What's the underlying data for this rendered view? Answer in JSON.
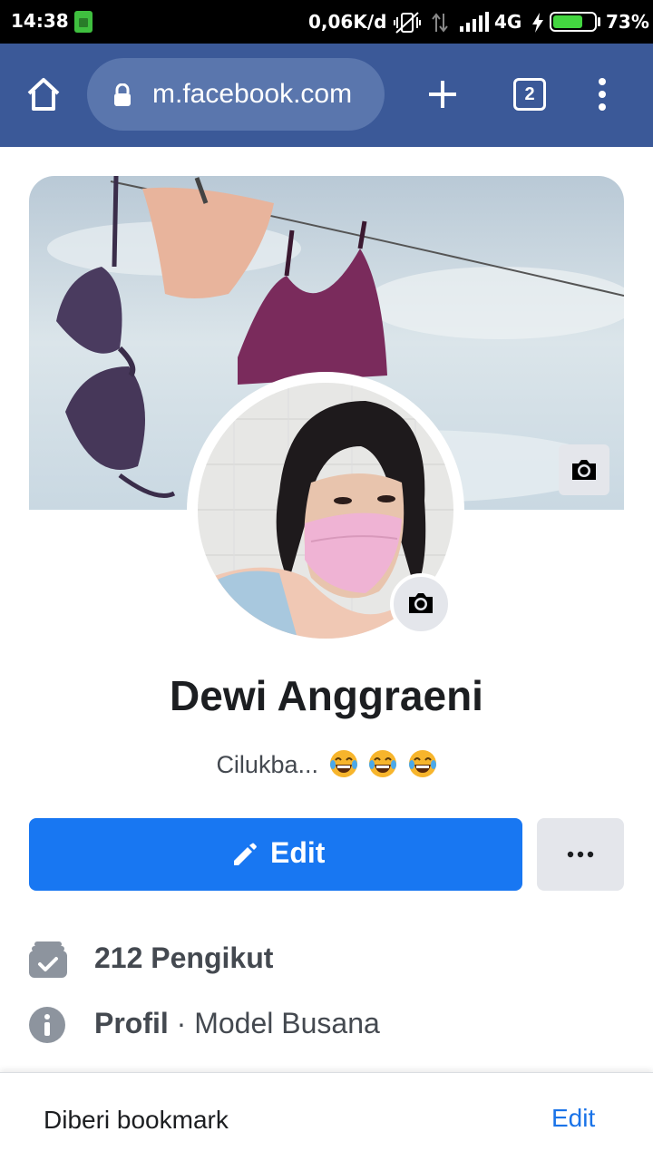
{
  "status_bar": {
    "time": "14:38",
    "network_speed": "0,06K/d",
    "network_type": "4G",
    "battery_percent": "73%",
    "battery_level": 0.73,
    "icons": [
      "sim-icon",
      "vibrate-off-icon",
      "data-arrows-icon",
      "signal-icon",
      "charging-icon",
      "battery-icon"
    ]
  },
  "browser": {
    "url": "m.facebook.com",
    "tab_count": "2",
    "toolbar_color": "#3b5998",
    "icons": [
      "home-icon",
      "lock-icon",
      "new-tab-icon",
      "tabs-icon",
      "menu-icon"
    ]
  },
  "profile": {
    "name": "Dewi Anggraeni",
    "bio": "Cilukba...",
    "bio_emoji_count": 3,
    "edit_label": "Edit",
    "accent": "#1877f2"
  },
  "details": {
    "followers": "212 Pengikut",
    "profile_label": "Profil",
    "profile_separator": " · ",
    "profile_category": "Model Busana"
  },
  "bookmark_bar": {
    "label": "Diberi bookmark",
    "edit_label": "Edit",
    "link_color": "#1a73e8"
  }
}
